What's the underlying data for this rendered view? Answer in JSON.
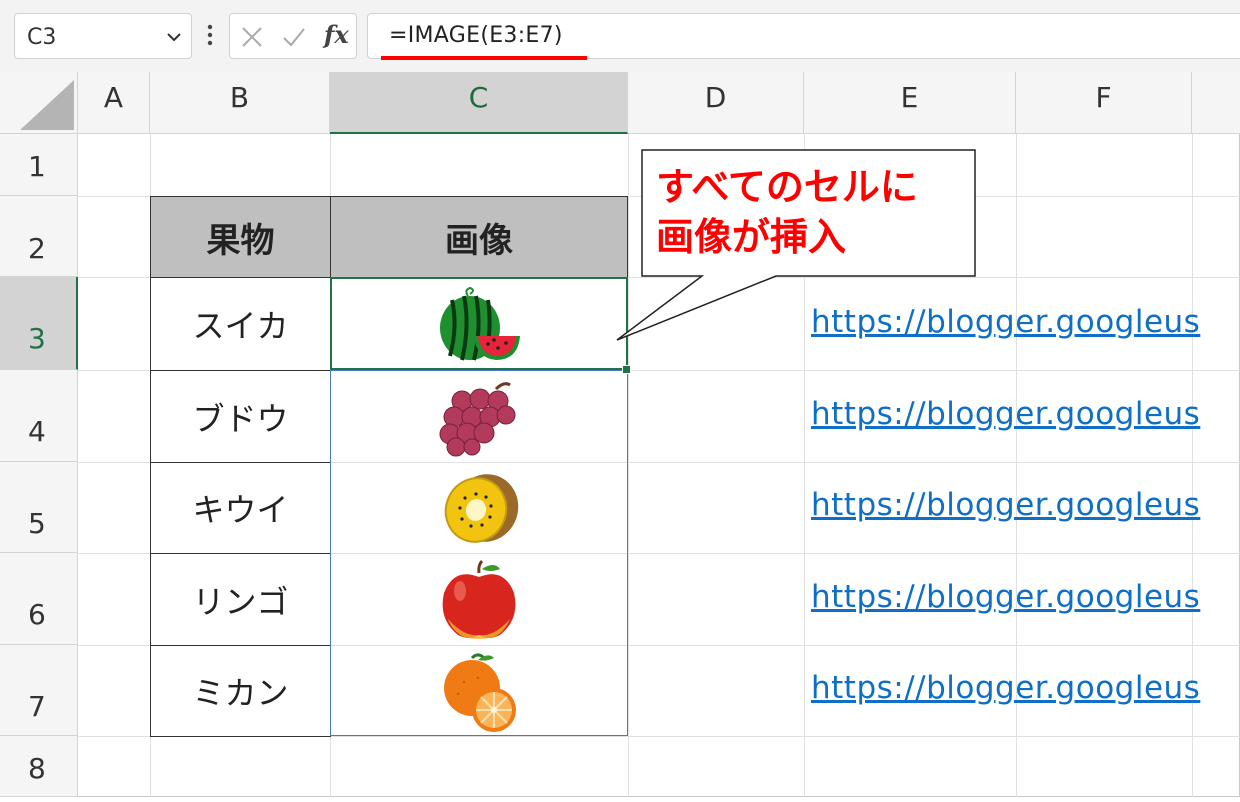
{
  "formula_bar": {
    "name_box": "C3",
    "cancel_icon": "x-icon",
    "enter_icon": "check-icon",
    "fx_label": "fx",
    "formula": "=IMAGE(E3:E7)"
  },
  "columns": [
    "A",
    "B",
    "C",
    "D",
    "E",
    "F"
  ],
  "rows": [
    "1",
    "2",
    "3",
    "4",
    "5",
    "6",
    "7",
    "8"
  ],
  "table": {
    "headers": [
      "果物",
      "画像"
    ],
    "fruits": [
      "スイカ",
      "ブドウ",
      "キウイ",
      "リンゴ",
      "ミカン"
    ],
    "images": [
      "watermelon-image",
      "grape-image",
      "kiwi-image",
      "apple-image",
      "orange-image"
    ]
  },
  "links": [
    "https://blogger.googleus",
    "https://blogger.googleus",
    "https://blogger.googleus",
    "https://blogger.googleus",
    "https://blogger.googleus"
  ],
  "callout": "すべてのセルに\n画像が挿入",
  "colors": {
    "selection_green": "#217346",
    "header_fill": "#bfbfbf",
    "link_blue": "#0f6fc6",
    "callout_red": "#ff0000"
  }
}
